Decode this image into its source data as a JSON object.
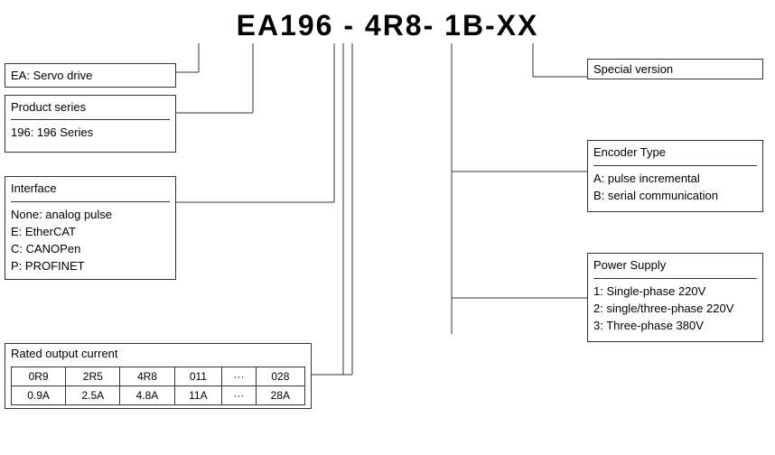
{
  "title": "EA196   -   4R8-  1B-XX",
  "boxes": {
    "ea": {
      "line1": "EA: Servo drive"
    },
    "series": {
      "line1": "Product series",
      "line2": "196: 196 Series"
    },
    "interface": {
      "label": "Interface",
      "items": [
        "None: analog pulse",
        "E: EtherCAT",
        "C: CANOPen",
        "P: PROFINET"
      ]
    },
    "current": {
      "label": "Rated output current",
      "headers": [
        "0R9",
        "2R5",
        "4R8",
        "011",
        "···",
        "028"
      ],
      "values": [
        "0.9A",
        "2.5A",
        "4.8A",
        "11A",
        "···",
        "28A"
      ]
    },
    "special": {
      "label": "Special version"
    },
    "encoder": {
      "label": "Encoder Type",
      "items": [
        "A: pulse incremental",
        "B: serial communication"
      ]
    },
    "power": {
      "label": "Power Supply",
      "items": [
        "1: Single-phase 220V",
        "2: single/three-phase 220V",
        "3: Three-phase 380V"
      ]
    }
  }
}
